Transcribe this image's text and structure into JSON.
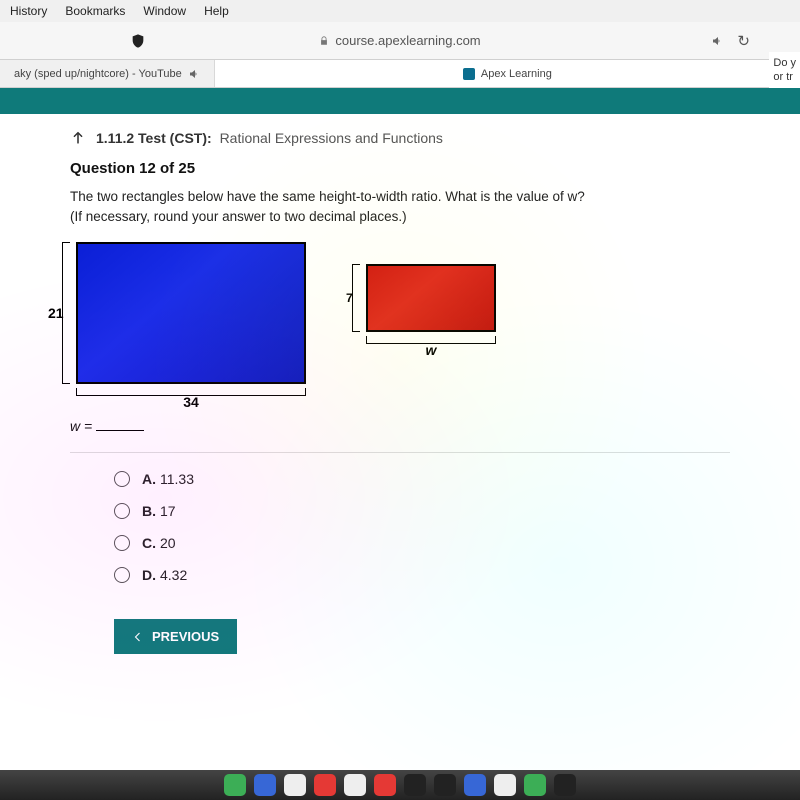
{
  "menubar": {
    "items": [
      "History",
      "Bookmarks",
      "Window",
      "Help"
    ]
  },
  "browser": {
    "url": "course.apexlearning.com",
    "tabs": [
      {
        "label": "aky (sped up/nightcore) - YouTube"
      },
      {
        "label": "Apex Learning"
      }
    ],
    "side_text_1": "Do y",
    "side_text_2": "or tr"
  },
  "breadcrumb": {
    "code": "1.11.2 Test (CST):",
    "title": "Rational Expressions and Functions"
  },
  "question": {
    "heading": "Question 12 of 25",
    "body": "The two rectangles below have the same height-to-width ratio. What is the value of w? (If necessary, round your answer to two decimal places.)",
    "blue_height": "21",
    "blue_width": "34",
    "red_height": "7",
    "red_width_label": "w",
    "var_line": "w ="
  },
  "options": [
    {
      "letter": "A.",
      "text": "11.33"
    },
    {
      "letter": "B.",
      "text": "17"
    },
    {
      "letter": "C.",
      "text": "20"
    },
    {
      "letter": "D.",
      "text": "4.32"
    }
  ],
  "buttons": {
    "previous": "PREVIOUS"
  }
}
